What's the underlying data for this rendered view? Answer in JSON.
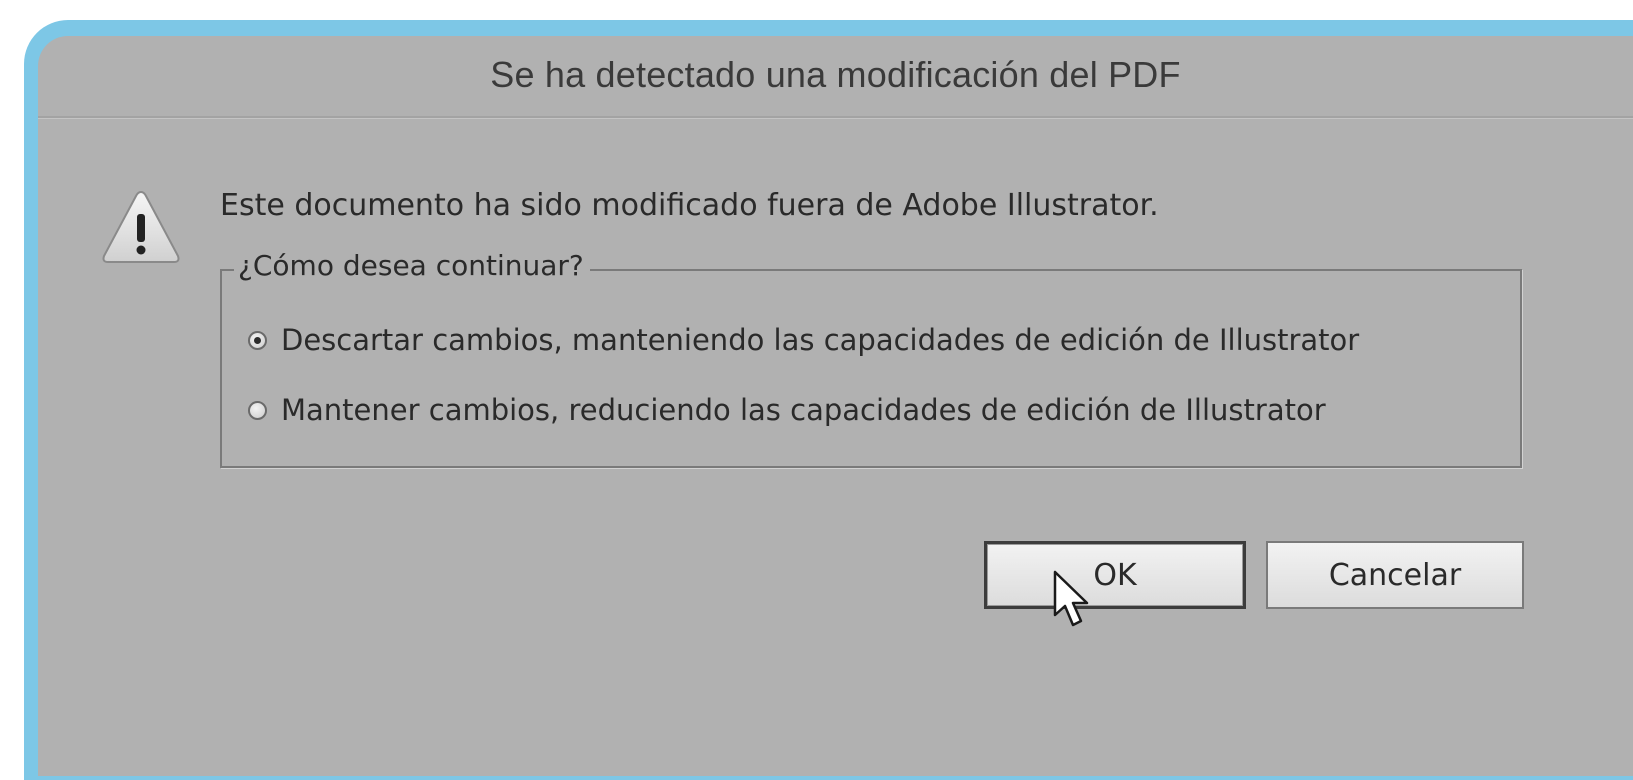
{
  "dialog": {
    "title": "Se ha detectado una modificación del PDF",
    "icon": "warning-icon",
    "message": "Este documento ha sido modificado fuera de Adobe Illustrator.",
    "options_group": {
      "legend": "¿Cómo desea continuar?",
      "options": [
        {
          "label": "Descartar cambios, manteniendo las capacidades de edición de Illustrator",
          "selected": true
        },
        {
          "label": "Mantener cambios, reduciendo las capacidades de edición de Illustrator",
          "selected": false
        }
      ]
    },
    "buttons": {
      "ok_label": "OK",
      "cancel_label": "Cancelar"
    },
    "colors": {
      "frame_accent": "#7dc7e6",
      "dialog_background": "#b1b1b1"
    }
  }
}
